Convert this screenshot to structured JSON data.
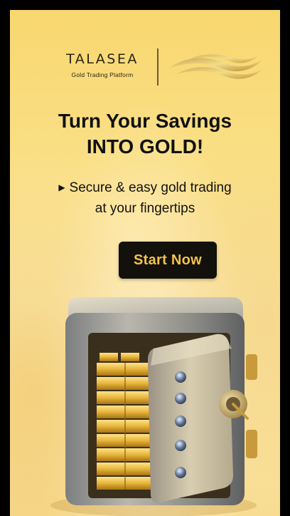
{
  "brand": {
    "name": "TALASEA",
    "tagline": "Gold Trading Platform"
  },
  "headline": {
    "line1": "Turn Your Savings",
    "line2": "INTO GOLD!"
  },
  "subheadline": {
    "bullet_icon": "triangle-right-icon",
    "line1": "Secure & easy gold trading",
    "line2": "at your fingertips"
  },
  "cta": {
    "label": "Start Now"
  },
  "colors": {
    "background_gold": "#fadf86",
    "cta_background": "#13110c",
    "cta_text": "#f2c24b",
    "headline_text": "#111111"
  }
}
